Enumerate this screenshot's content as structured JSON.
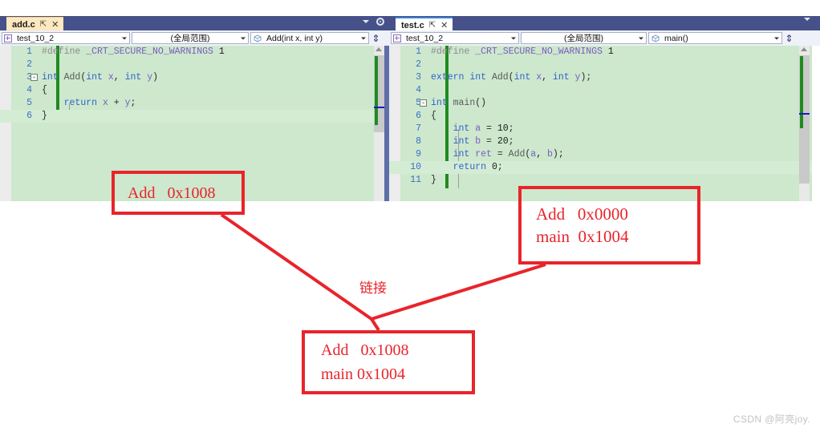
{
  "windows": [
    {
      "id": "left",
      "tab": {
        "title": "add.c",
        "pin_icon": "pin-icon",
        "close_icon": "close-icon"
      },
      "nav": {
        "project": "test_10_2",
        "scope": "(全局范围)",
        "member": "Add(int x, int y)",
        "split_icon": "split-view-icon"
      },
      "lines": [
        {
          "n": "1",
          "segs": [
            {
              "t": "#define ",
              "c": "tk-pp"
            },
            {
              "t": "_CRT_SECURE_NO_WARNINGS",
              "c": "tk-ppid"
            },
            {
              "t": " 1",
              "c": "tk-num"
            }
          ]
        },
        {
          "n": "2",
          "segs": []
        },
        {
          "n": "3",
          "fold": "-",
          "segs": [
            {
              "t": "int",
              "c": "tk-kw"
            },
            {
              "t": " ",
              "c": "tk-plain"
            },
            {
              "t": "Add",
              "c": "tk-fn"
            },
            {
              "t": "(",
              "c": "tk-plain"
            },
            {
              "t": "int",
              "c": "tk-kw"
            },
            {
              "t": " ",
              "c": "tk-plain"
            },
            {
              "t": "x",
              "c": "tk-var"
            },
            {
              "t": ", ",
              "c": "tk-plain"
            },
            {
              "t": "int",
              "c": "tk-kw"
            },
            {
              "t": " ",
              "c": "tk-plain"
            },
            {
              "t": "y",
              "c": "tk-var"
            },
            {
              "t": ")",
              "c": "tk-plain"
            }
          ]
        },
        {
          "n": "4",
          "segs": [
            {
              "t": "{",
              "c": "tk-plain"
            }
          ]
        },
        {
          "n": "5",
          "segs": [
            {
              "t": "    ",
              "c": "tk-plain"
            },
            {
              "t": "return",
              "c": "tk-kw"
            },
            {
              "t": " ",
              "c": "tk-plain"
            },
            {
              "t": "x",
              "c": "tk-var"
            },
            {
              "t": " + ",
              "c": "tk-op"
            },
            {
              "t": "y",
              "c": "tk-var"
            },
            {
              "t": ";",
              "c": "tk-plain"
            }
          ]
        },
        {
          "n": "6",
          "current": true,
          "segs": [
            {
              "t": "}",
              "c": "tk-plain"
            }
          ]
        }
      ]
    },
    {
      "id": "right",
      "tab": {
        "title": "test.c",
        "pin_icon": "pin-icon",
        "close_icon": "close-icon"
      },
      "nav": {
        "project": "test_10_2",
        "scope": "(全局范围)",
        "member": "main()",
        "split_icon": "split-view-icon"
      },
      "lines": [
        {
          "n": "1",
          "segs": [
            {
              "t": "#define ",
              "c": "tk-pp"
            },
            {
              "t": "_CRT_SECURE_NO_WARNINGS",
              "c": "tk-ppid"
            },
            {
              "t": " 1",
              "c": "tk-num"
            }
          ]
        },
        {
          "n": "2",
          "segs": []
        },
        {
          "n": "3",
          "segs": [
            {
              "t": "extern",
              "c": "tk-kw"
            },
            {
              "t": " ",
              "c": "tk-plain"
            },
            {
              "t": "int",
              "c": "tk-kw"
            },
            {
              "t": " ",
              "c": "tk-plain"
            },
            {
              "t": "Add",
              "c": "tk-fn"
            },
            {
              "t": "(",
              "c": "tk-plain"
            },
            {
              "t": "int",
              "c": "tk-kw"
            },
            {
              "t": " ",
              "c": "tk-plain"
            },
            {
              "t": "x",
              "c": "tk-var"
            },
            {
              "t": ", ",
              "c": "tk-plain"
            },
            {
              "t": "int",
              "c": "tk-kw"
            },
            {
              "t": " ",
              "c": "tk-plain"
            },
            {
              "t": "y",
              "c": "tk-var"
            },
            {
              "t": ");",
              "c": "tk-plain"
            }
          ]
        },
        {
          "n": "4",
          "segs": []
        },
        {
          "n": "5",
          "fold": "-",
          "segs": [
            {
              "t": "int",
              "c": "tk-kw"
            },
            {
              "t": " ",
              "c": "tk-plain"
            },
            {
              "t": "main",
              "c": "tk-fn"
            },
            {
              "t": "()",
              "c": "tk-plain"
            }
          ]
        },
        {
          "n": "6",
          "segs": [
            {
              "t": "{",
              "c": "tk-plain"
            }
          ]
        },
        {
          "n": "7",
          "segs": [
            {
              "t": "    ",
              "c": "tk-plain"
            },
            {
              "t": "int",
              "c": "tk-kw"
            },
            {
              "t": " ",
              "c": "tk-plain"
            },
            {
              "t": "a",
              "c": "tk-var"
            },
            {
              "t": " = ",
              "c": "tk-op"
            },
            {
              "t": "10",
              "c": "tk-num"
            },
            {
              "t": ";",
              "c": "tk-plain"
            }
          ]
        },
        {
          "n": "8",
          "segs": [
            {
              "t": "    ",
              "c": "tk-plain"
            },
            {
              "t": "int",
              "c": "tk-kw"
            },
            {
              "t": " ",
              "c": "tk-plain"
            },
            {
              "t": "b",
              "c": "tk-var"
            },
            {
              "t": " = ",
              "c": "tk-op"
            },
            {
              "t": "20",
              "c": "tk-num"
            },
            {
              "t": ";",
              "c": "tk-plain"
            }
          ]
        },
        {
          "n": "9",
          "segs": [
            {
              "t": "    ",
              "c": "tk-plain"
            },
            {
              "t": "int",
              "c": "tk-kw"
            },
            {
              "t": " ",
              "c": "tk-plain"
            },
            {
              "t": "ret",
              "c": "tk-var"
            },
            {
              "t": " = ",
              "c": "tk-op"
            },
            {
              "t": "Add",
              "c": "tk-fn"
            },
            {
              "t": "(",
              "c": "tk-plain"
            },
            {
              "t": "a",
              "c": "tk-var"
            },
            {
              "t": ", ",
              "c": "tk-plain"
            },
            {
              "t": "b",
              "c": "tk-var"
            },
            {
              "t": ");",
              "c": "tk-plain"
            }
          ]
        },
        {
          "n": "10",
          "current": true,
          "segs": [
            {
              "t": "    ",
              "c": "tk-plain"
            },
            {
              "t": "return",
              "c": "tk-kw"
            },
            {
              "t": " ",
              "c": "tk-plain"
            },
            {
              "t": "0",
              "c": "tk-num"
            },
            {
              "t": ";",
              "c": "tk-plain"
            }
          ]
        },
        {
          "n": "11",
          "segs": [
            {
              "t": "}",
              "c": "tk-plain"
            }
          ]
        }
      ]
    }
  ],
  "annotations": {
    "color": "#e8242b",
    "box_add_obj": {
      "lines": [
        "Add   0x1008"
      ]
    },
    "box_test_obj": {
      "lines": [
        "Add   0x0000",
        "main  0x1004"
      ]
    },
    "box_linked": {
      "lines": [
        "Add   0x1008",
        "main 0x1004"
      ]
    },
    "link_label": "链接"
  },
  "watermark": "CSDN @阿亮joy."
}
